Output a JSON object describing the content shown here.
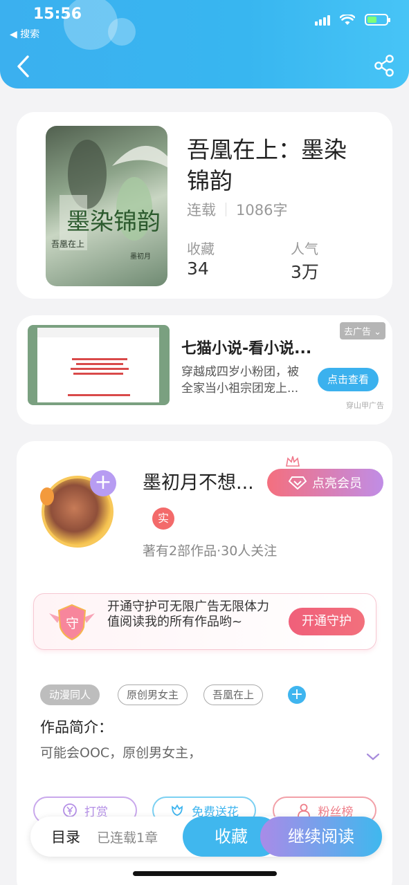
{
  "status_bar": {
    "time": "15:56",
    "back_label": "◀ 搜索"
  },
  "book": {
    "title": "吾凰在上：墨染锦韵",
    "status": "连载",
    "word_count": "1086字",
    "collect_label": "收藏",
    "collect_value": "34",
    "popularity_label": "人气",
    "popularity_value": "3万",
    "cover_title": "墨染锦韵",
    "cover_subtitle": "吾凰在上",
    "cover_author": "墨初月"
  },
  "ad": {
    "title": "七猫小说-看小说...",
    "description": "穿越成四岁小粉团，被全家当小祖宗团宠上...",
    "close_label": "去广告",
    "cta_label": "点击查看",
    "source": "穿山甲广告"
  },
  "author": {
    "name": "墨初月不想...",
    "vip_label": "点亮会员",
    "real_badge": "实",
    "stats": "著有2部作品·30人关注"
  },
  "guard": {
    "icon_text": "守",
    "text": "开通守护可无限广告无限体力值阅读我的所有作品哟~",
    "button_label": "开通守护"
  },
  "tags": [
    "动漫同人",
    "原创男女主",
    "吾凰在上"
  ],
  "intro": {
    "label": "作品简介：",
    "text": "可能会OOC，原创男女主，"
  },
  "actions": {
    "tip_label": "打赏",
    "flower_label": "免费送花",
    "fans_label": "粉丝榜"
  },
  "bottom_bar": {
    "toc_label": "目录",
    "chapters_label": "已连载1章",
    "favorite_label": "收藏",
    "continue_label": "继续阅读"
  },
  "colors": {
    "primary": "#3bb1ee",
    "vip_gradient_start": "#f46f7e",
    "vip_gradient_end": "#c08de6",
    "guard_button": "#f05f7a"
  }
}
